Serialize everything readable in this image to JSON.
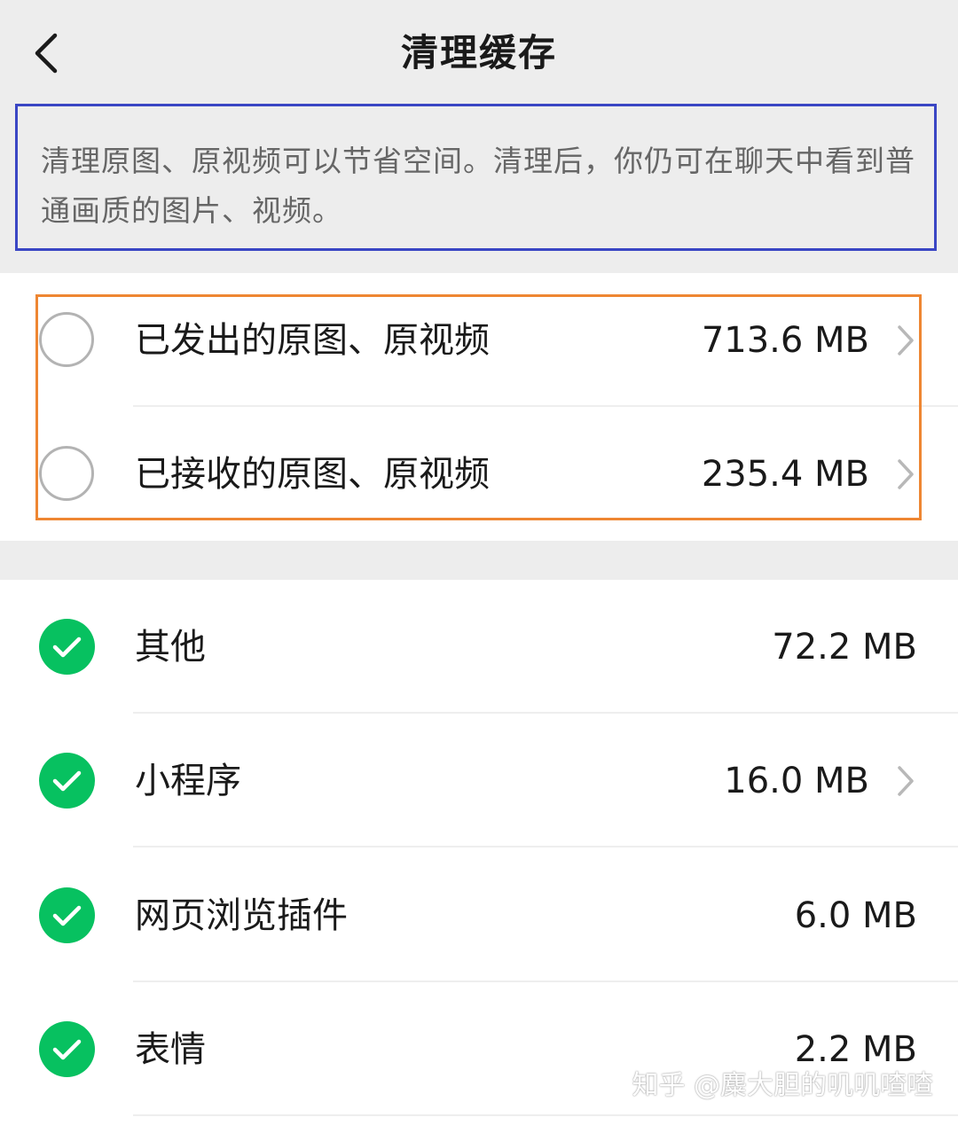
{
  "nav": {
    "title": "清理缓存",
    "back_icon": "chevron-left-icon"
  },
  "notice": {
    "text": "清理原图、原视频可以节省空间。清理后，你仍可在聊天中看到普通画质的图片、视频。"
  },
  "original_media": [
    {
      "label": "已发出的原图、原视频",
      "size": "713.6 MB",
      "selected": false,
      "has_chevron": true
    },
    {
      "label": "已接收的原图、原视频",
      "size": "235.4 MB",
      "selected": false,
      "has_chevron": true
    }
  ],
  "cache_items": [
    {
      "label": "其他",
      "size": "72.2 MB",
      "selected": true,
      "has_chevron": false
    },
    {
      "label": "小程序",
      "size": "16.0 MB",
      "selected": true,
      "has_chevron": true
    },
    {
      "label": "网页浏览插件",
      "size": "6.0 MB",
      "selected": true,
      "has_chevron": false
    },
    {
      "label": "表情",
      "size": "2.2 MB",
      "selected": true,
      "has_chevron": false
    }
  ],
  "watermark": "知乎 @麋大胆的叽叽喳喳",
  "colors": {
    "background": "#ededed",
    "check_green": "#07c160",
    "notice_border": "#3a46c4",
    "highlight_border": "#ee8632"
  }
}
